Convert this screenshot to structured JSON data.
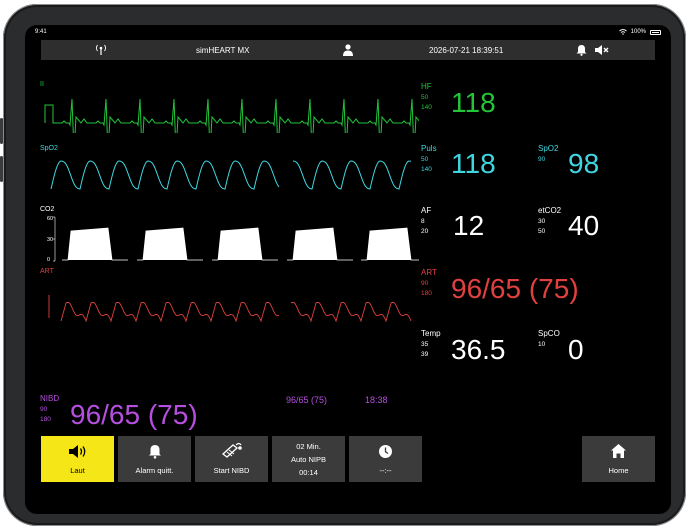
{
  "status_bar": {
    "time": "9:41",
    "battery": "100%"
  },
  "header": {
    "title": "simHEART MX",
    "datetime": "2026-07-21 18:39:51"
  },
  "colors": {
    "ecg": "#22c53a",
    "spo2": "#3fd6e2",
    "co2": "#ffffff",
    "art": "#e04040",
    "nibp": "#b64fe0",
    "accent": "#f5e617"
  },
  "waves": {
    "ecg": {
      "label": "II"
    },
    "spo2": {
      "label": "SpO2"
    },
    "co2": {
      "label": "CO2",
      "scale": [
        "60",
        "30",
        "0"
      ]
    },
    "art": {
      "label": "ART"
    }
  },
  "vitals": {
    "hf": {
      "label": "HF",
      "lo": "50",
      "hi": "140",
      "value": "118"
    },
    "puls": {
      "label": "Puls",
      "lo": "50",
      "hi": "140",
      "value": "118"
    },
    "spo2": {
      "label": "SpO2",
      "lo": "90",
      "value": "98"
    },
    "af": {
      "label": "AF",
      "lo": "8",
      "hi": "20",
      "value": "12"
    },
    "etco2": {
      "label": "etCO2",
      "lo": "30",
      "hi": "50",
      "value": "40"
    },
    "art": {
      "label": "ART",
      "lo": "90",
      "hi": "180",
      "value": "96/65 (75)"
    },
    "temp": {
      "label": "Temp",
      "lo": "35",
      "hi": "39",
      "value": "36.5"
    },
    "spco": {
      "label": "SpCO",
      "lo": "10",
      "value": "0"
    }
  },
  "nibd": {
    "label": "NIBD",
    "lo": "90",
    "hi": "180",
    "value": "96/65 (75)",
    "last_value": "96/65 (75)",
    "last_time": "18:38"
  },
  "buttons": {
    "laut": "Laut",
    "alarm": "Alarm quitt.",
    "start_nibd": "Start NIBD",
    "interval_line1": "02 Min.",
    "interval_line2": "Auto NIPB",
    "interval_line3": "00:14",
    "timer": "--:--",
    "home": "Home"
  },
  "icons": [
    "antenna-icon",
    "person-icon",
    "bell-icon",
    "speaker-mute-icon",
    "speaker-icon",
    "cuff-icon",
    "clock-icon",
    "home-icon"
  ]
}
